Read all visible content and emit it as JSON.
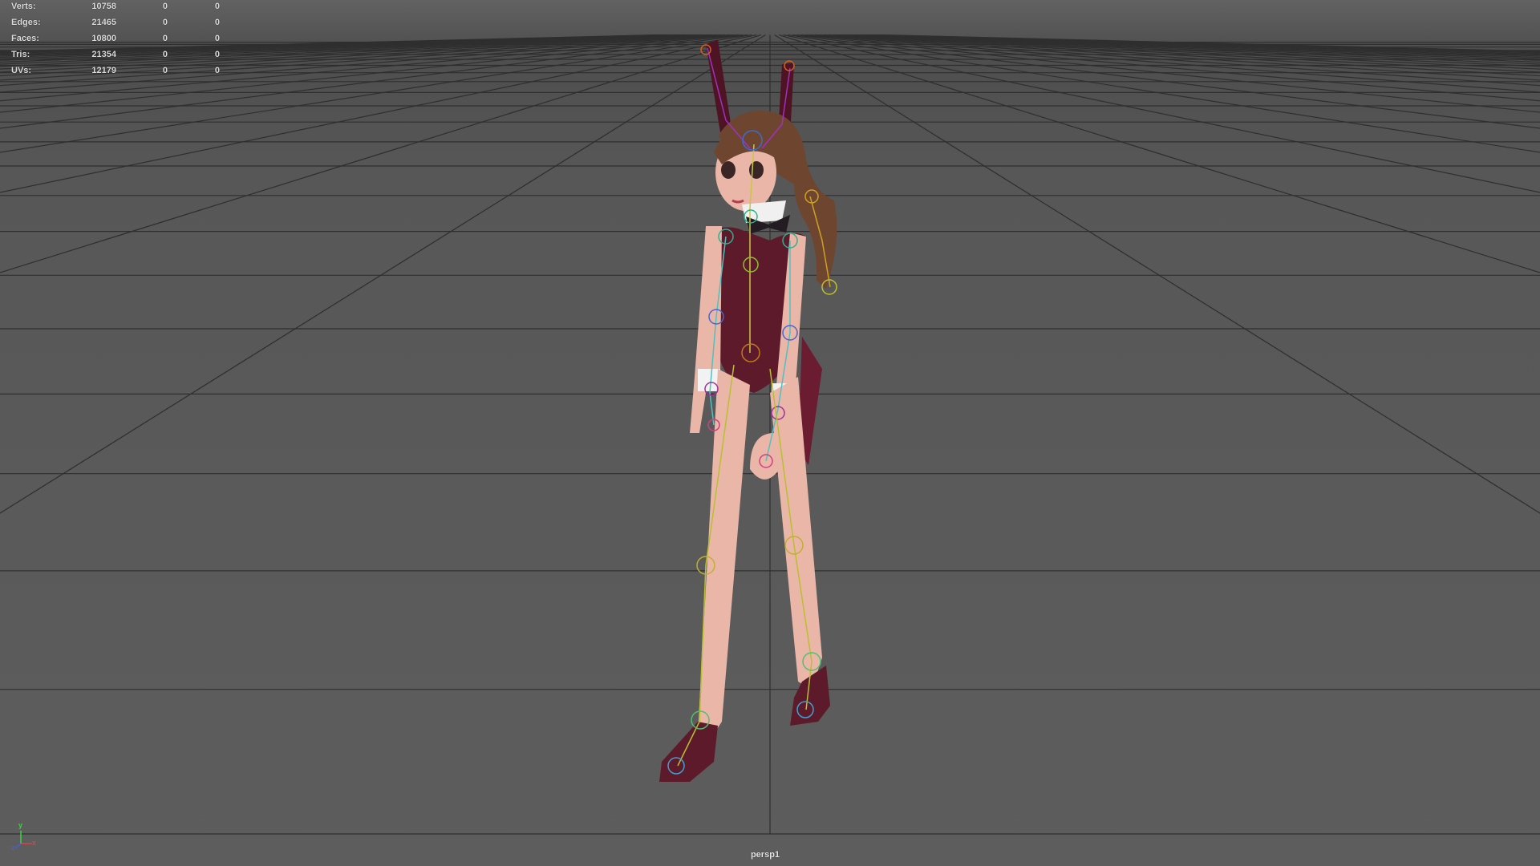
{
  "hud": {
    "stats": [
      {
        "label": "Verts:",
        "total": "10758",
        "selected": "0",
        "component": "0"
      },
      {
        "label": "Edges:",
        "total": "21465",
        "selected": "0",
        "component": "0"
      },
      {
        "label": "Faces:",
        "total": "10800",
        "selected": "0",
        "component": "0"
      },
      {
        "label": "Tris:",
        "total": "21354",
        "selected": "0",
        "component": "0"
      },
      {
        "label": "UVs:",
        "total": "12179",
        "selected": "0",
        "component": "0"
      }
    ]
  },
  "viewport": {
    "camera_name": "persp1",
    "background_color": "#5b5b5b",
    "grid_color": "#2f2f2f",
    "character": {
      "skin_color": "#e9b3a6",
      "outfit_color": "#5c1a2a",
      "hair_color": "#6e4630"
    }
  },
  "axis_gizmo": {
    "x_label": "x",
    "y_label": "y",
    "z_label": "z"
  },
  "colors": {
    "hud_text": "#dcdcdc",
    "axis_x": "#e04040",
    "axis_y": "#40d040",
    "axis_z": "#4060e0"
  }
}
